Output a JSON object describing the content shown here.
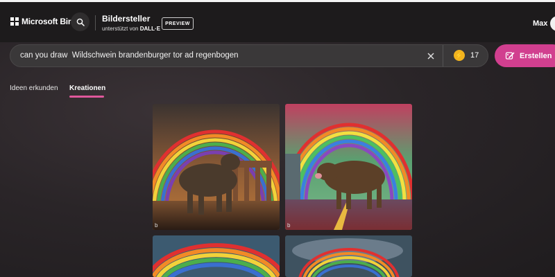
{
  "header": {
    "brand": "Microsoft Bing",
    "product_title": "Bildersteller",
    "product_subtitle_prefix": "unterstützt von",
    "product_subtitle_brand": "DALL·E",
    "preview_badge": "PREVIEW",
    "user_name": "Max"
  },
  "prompt": {
    "value": "can you draw  Wildschwein brandenburger tor ad regenbogen",
    "boost_count": "17",
    "create_label": "Erstellen"
  },
  "tabs": [
    {
      "label": "Ideen erkunden",
      "active": false
    },
    {
      "label": "Kreationen",
      "active": true
    }
  ],
  "images": [
    {
      "name": "generated-image-1",
      "description": "boar with rainbow and Brandenburg Gate, sunset"
    },
    {
      "name": "generated-image-2",
      "description": "boar with rainbow, bright colors"
    },
    {
      "name": "generated-image-3",
      "description": "rainbow under cloudy sky"
    },
    {
      "name": "generated-image-4",
      "description": "rainbow under cloudy sky"
    }
  ],
  "colors": {
    "accent": "#d13f8f",
    "tab_underline": "#e0589c",
    "boost": "#f2b41e",
    "header_bg": "#1d1b1c"
  },
  "icons": {
    "search": "search-icon",
    "clear": "close-icon",
    "boost": "boost-icon",
    "create": "create-icon"
  }
}
